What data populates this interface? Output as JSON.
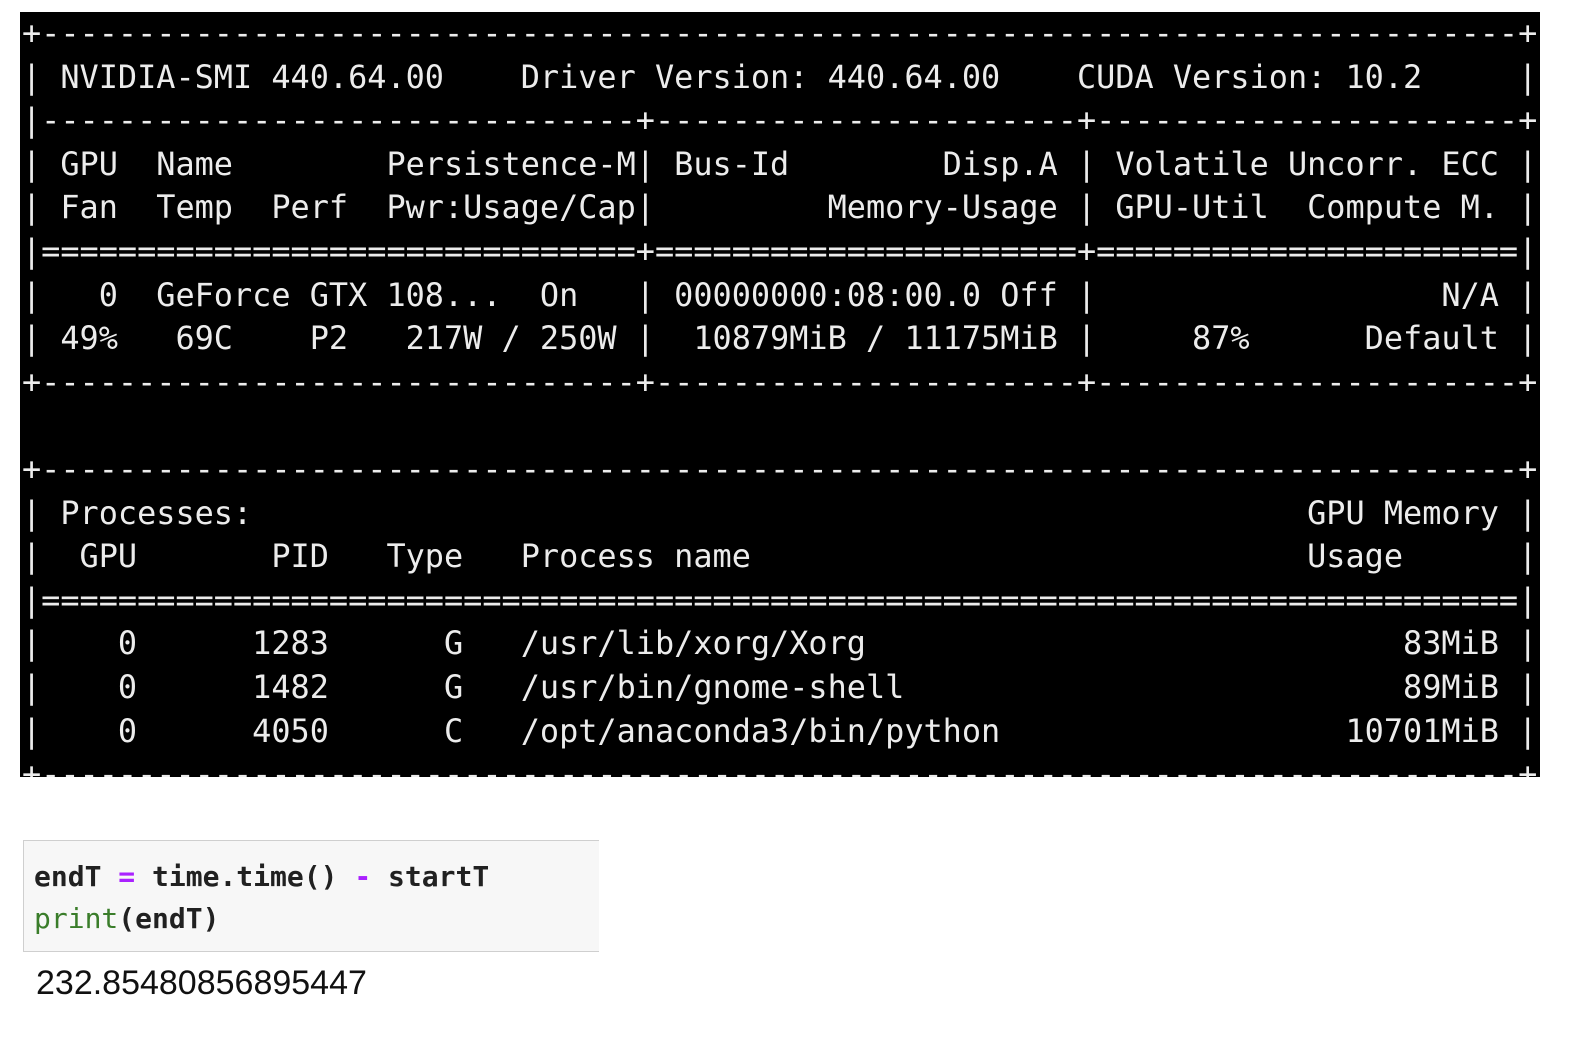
{
  "terminal": {
    "lines": [
      "+-----------------------------------------------------------------------------+",
      "| NVIDIA-SMI 440.64.00    Driver Version: 440.64.00    CUDA Version: 10.2     |",
      "|-------------------------------+----------------------+----------------------+",
      "| GPU  Name        Persistence-M| Bus-Id        Disp.A | Volatile Uncorr. ECC |",
      "| Fan  Temp  Perf  Pwr:Usage/Cap|         Memory-Usage | GPU-Util  Compute M. |",
      "|===============================+======================+======================|",
      "|   0  GeForce GTX 108...  On   | 00000000:08:00.0 Off |                  N/A |",
      "| 49%   69C    P2   217W / 250W |  10879MiB / 11175MiB |     87%      Default |",
      "+-------------------------------+----------------------+----------------------+",
      "",
      "+-----------------------------------------------------------------------------+",
      "| Processes:                                                       GPU Memory |",
      "|  GPU       PID   Type   Process name                             Usage      |",
      "|=============================================================================|",
      "|    0      1283      G   /usr/lib/xorg/Xorg                            83MiB |",
      "|    0      1482      G   /usr/bin/gnome-shell                          89MiB |",
      "|    0      4050      C   /opt/anaconda3/bin/python                  10701MiB |",
      "+-----------------------------------------------------------------------------+"
    ]
  },
  "code_cell": {
    "line1": {
      "var": "endT ",
      "op1": "=",
      "mid": " time.time() ",
      "op2": "-",
      "tail": " startT"
    },
    "line2": {
      "builtin": "print",
      "rest": "(endT)"
    }
  },
  "output": "232.85480856895447",
  "colors": {
    "terminal_bg": "#000000",
    "terminal_fg": "#ececec",
    "operator": "#aa22ff",
    "builtin": "#3a7d2a"
  }
}
